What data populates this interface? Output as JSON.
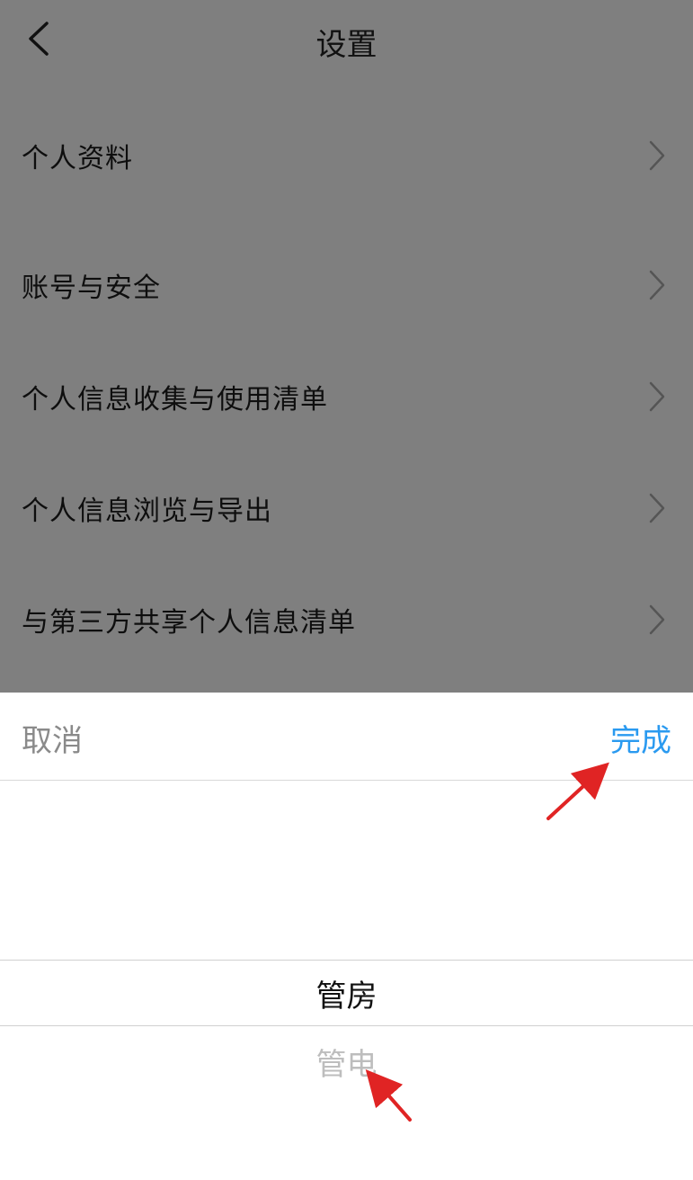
{
  "header": {
    "title": "设置"
  },
  "settings_items": [
    {
      "label": "个人资料"
    },
    {
      "label": "账号与安全"
    },
    {
      "label": "个人信息收集与使用清单"
    },
    {
      "label": "个人信息浏览与导出"
    },
    {
      "label": "与第三方共享个人信息清单"
    }
  ],
  "picker_sheet": {
    "cancel_label": "取消",
    "done_label": "完成",
    "options": [
      {
        "label": "管房",
        "state": "selected"
      },
      {
        "label": "管电",
        "state": "unselected"
      }
    ]
  },
  "icons": {
    "back": "chevron-left-icon",
    "row": "chevron-right-icon"
  },
  "colors": {
    "accent": "#2a9af0",
    "overlay": "rgba(0,0,0,0.5)",
    "annotation_arrow": "#e02424"
  }
}
